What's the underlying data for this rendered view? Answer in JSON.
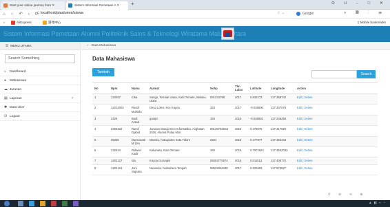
{
  "browser": {
    "tabs": [
      {
        "label": "Start your online journey from ✕",
        "active": false,
        "icon_color": "#e8753a"
      },
      {
        "label": "Sistem Informasi Pemetaan A ✕",
        "active": true,
        "icon_color": "#1d7fb5"
      }
    ],
    "url": "localhost/pisalumni/siswa",
    "search_placeholder": "Google",
    "bookmarks": [
      {
        "label": "AliExpress",
        "icon_color": "#e63b2e"
      },
      {
        "label": "游戏中心",
        "icon_color": "#f6a623"
      }
    ],
    "mobile_bookmarks": "Mobile bookmarks"
  },
  "header": {
    "title": "Sistem Informasi Pemetaan Alumni Politeknik Sains & Teknologi Wiratama Maluku Utara"
  },
  "sidebar": {
    "menu_title": "MENU UTAMA",
    "search_placeholder": "Search Something",
    "items": [
      {
        "label": "Dashboard",
        "icon": "home-icon"
      },
      {
        "label": "Mahasiswa",
        "icon": "user-icon"
      },
      {
        "label": "Jurusan",
        "icon": "cloud-icon"
      },
      {
        "label": "Laporan",
        "icon": "file-icon",
        "has_submenu": true
      },
      {
        "label": "Data User",
        "icon": "gear-icon"
      },
      {
        "label": "Logout",
        "icon": "logout-icon"
      }
    ]
  },
  "main": {
    "breadcrumb": "Data Mahasiswa",
    "page_title": "Data Mahasiswa",
    "add_button": "Tambah",
    "search_button": "Search",
    "columns": [
      "No",
      "Npm",
      "Nama",
      "Alamat",
      "Nohp",
      "Thn Lulus",
      "Latitude",
      "Longitude",
      "Action"
    ],
    "rows": [
      [
        "1",
        "123457",
        "Cika",
        "Sango, Ternate Utara, Kota Ternate, Maluku Utara",
        "081234788",
        "2017",
        "0.832273",
        "127.368742",
        "Edit | Delete"
      ],
      [
        "2",
        "12212003",
        "Rusdi Muhidin",
        "Desa Loleo, Kec Kayoa",
        "323",
        "2017",
        "-0.026800",
        "127.247079",
        "Edit | Delete"
      ],
      [
        "3",
        "2324",
        "Budi Arsad",
        "gurapi",
        "334",
        "2015",
        "-0.026920",
        "127.246258",
        "Edit | Delete"
      ],
      [
        "4",
        "2303422",
        "Ramli Djabid",
        "Jurusan Manajemen Informatika, Angkatan 2016, Alamat Pulau Moti",
        "081267536S4",
        "2016",
        "0.478075",
        "127.417920",
        "Edit | Delete"
      ],
      [
        "5",
        "35335",
        "Darmawati M Zen",
        "Mareku, Kabupaten Kota Tidore",
        "2324",
        "2015",
        "0.477977",
        "127.362434",
        "Edit | Delete"
      ],
      [
        "6",
        "232424",
        "Ridwan Kadir",
        "Kalumata, Kota Ternate",
        "345",
        "2016",
        "0.7672624",
        "127.3632033",
        "Edit | Delete"
      ],
      [
        "7",
        "1202127",
        "Ida",
        "Kayoa Guruapin",
        "08253770674",
        "2015",
        "0.011513",
        "127.409775",
        "Edit | Delete"
      ],
      [
        "8",
        "1202124",
        "Joni Saputra",
        "Nurweda, halmahera Tengah",
        "08529346345",
        "2017",
        "0.322993",
        "127.873827",
        "Edit | Delete"
      ]
    ]
  }
}
